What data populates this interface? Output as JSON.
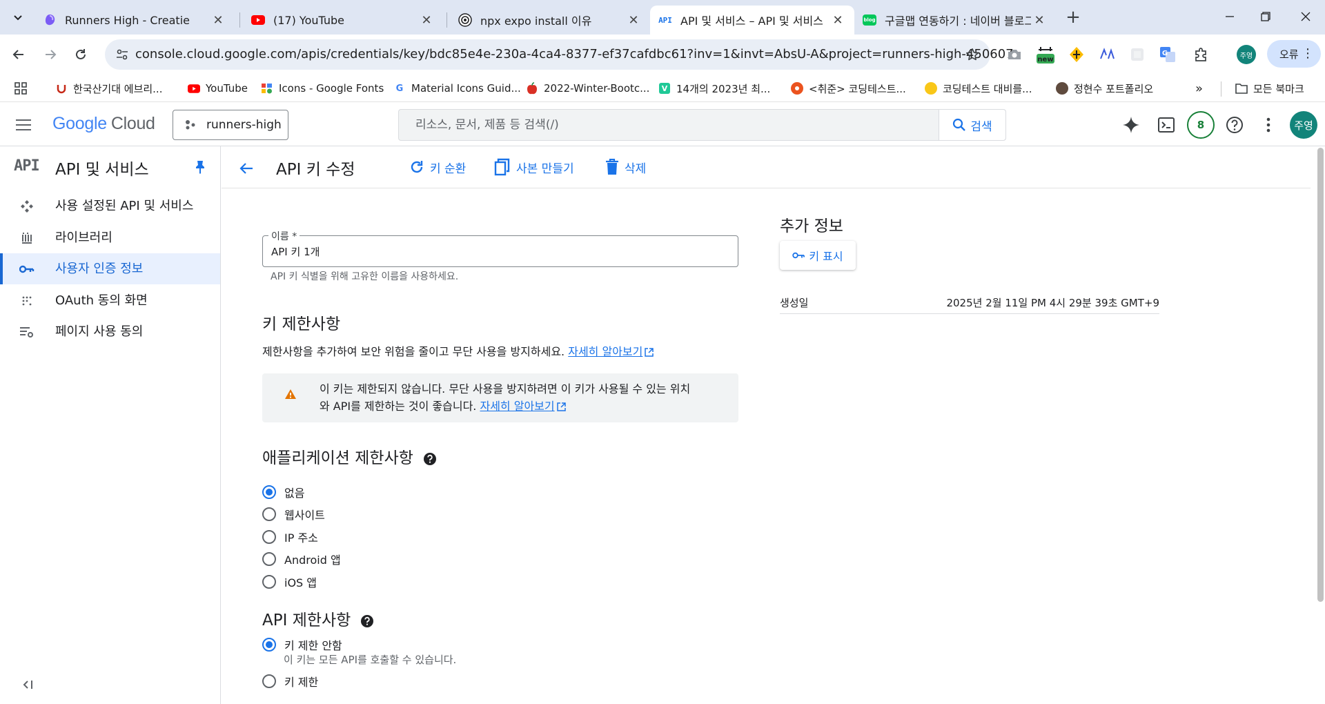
{
  "browser": {
    "tabs": [
      {
        "title": "Runners High - Creatie",
        "active": false
      },
      {
        "title": "(17) YouTube",
        "active": false
      },
      {
        "title": "npx expo install 이유",
        "active": false
      },
      {
        "title": "API 및 서비스 – API 및 서비스",
        "active": true
      },
      {
        "title": "구글맵 연동하기 : 네이버 블로그",
        "active": false
      }
    ],
    "active_tab_favicon": "API",
    "blog_favicon": "blog",
    "url": "console.cloud.google.com/apis/credentials/key/bdc85e4e-230a-4ca4-8377-ef37cafdbc61?inv=1&invt=AbsU-A&project=runners-high-450607",
    "new_badge": "new",
    "profile_avatar": "주영",
    "profile_label": "오류",
    "bookmarks": [
      {
        "label": "한국산기대 에브리...",
        "icon": "everytime"
      },
      {
        "label": "YouTube",
        "icon": "youtube"
      },
      {
        "label": "Icons - Google Fonts",
        "icon": "google-fonts"
      },
      {
        "label": "Material Icons Guid...",
        "icon": "google"
      },
      {
        "label": "2022-Winter-Bootc...",
        "icon": "apple"
      },
      {
        "label": "14개의 2023년 최...",
        "icon": "velog"
      },
      {
        "label": "<취준> 코딩테스트...",
        "icon": "tistory"
      },
      {
        "label": "코딩테스트 대비를...",
        "icon": "yellow-circle"
      },
      {
        "label": "정현수 포트폴리오",
        "icon": "portrait"
      }
    ],
    "bookmarks_more": "»",
    "all_bookmarks": "모든 북마크"
  },
  "gcp": {
    "logo_google": "Google",
    "logo_cloud": "Cloud",
    "project": "runners-high",
    "search_placeholder": "리소스, 문서, 제품 등 검색(/)",
    "search_button": "검색",
    "notifications": "8",
    "avatar": "주영"
  },
  "nav": {
    "logo": "API",
    "title": "API 및 서비스",
    "items": [
      {
        "label": "사용 설정된 API 및 서비스",
        "icon": "api-hub-icon",
        "active": false
      },
      {
        "label": "라이브러리",
        "icon": "library-icon",
        "active": false
      },
      {
        "label": "사용자 인증 정보",
        "icon": "key-icon",
        "active": true
      },
      {
        "label": "OAuth 동의 화면",
        "icon": "oauth-dots-icon",
        "active": false
      },
      {
        "label": "페이지 사용 동의",
        "icon": "settings-list-icon",
        "active": false
      }
    ]
  },
  "page": {
    "title": "API 키 수정",
    "actions": {
      "rotate": "키 순환",
      "copy": "사본 만들기",
      "delete": "삭제"
    },
    "name_field": {
      "label": "이름 *",
      "value": "API 키 1개",
      "hint": "API 키 식별을 위해 고유한 이름을 사용하세요."
    },
    "key_restrictions": {
      "title": "키 제한사항",
      "description": "제한사항을 추가하여 보안 위험을 줄이고 무단 사용을 방지하세요.",
      "learn_more": "자세히 알아보기",
      "warning_line1": "이 키는 제한되지 않습니다. 무단 사용을 방지하려면 이 키가 사용될 수 있는 위치",
      "warning_line2": "와 API를 제한하는 것이 좋습니다.",
      "warning_learn_more": "자세히 알아보기"
    },
    "app_restrictions": {
      "title": "애플리케이션 제한사항",
      "options": [
        "없음",
        "웹사이트",
        "IP 주소",
        "Android 앱",
        "iOS 앱"
      ],
      "selected": "없음"
    },
    "api_restrictions": {
      "title": "API 제한사항",
      "options": [
        "키 제한 안함",
        "키 제한"
      ],
      "selected": "키 제한 안함",
      "unrestricted_hint": "이 키는 모든 API를 호출할 수 있습니다."
    },
    "additional_info": {
      "title": "추가 정보",
      "show_key": "키 표시",
      "created_label": "생성일",
      "created_value": "2025년 2월 11일 PM 4시 29분 39초 GMT+9"
    }
  }
}
